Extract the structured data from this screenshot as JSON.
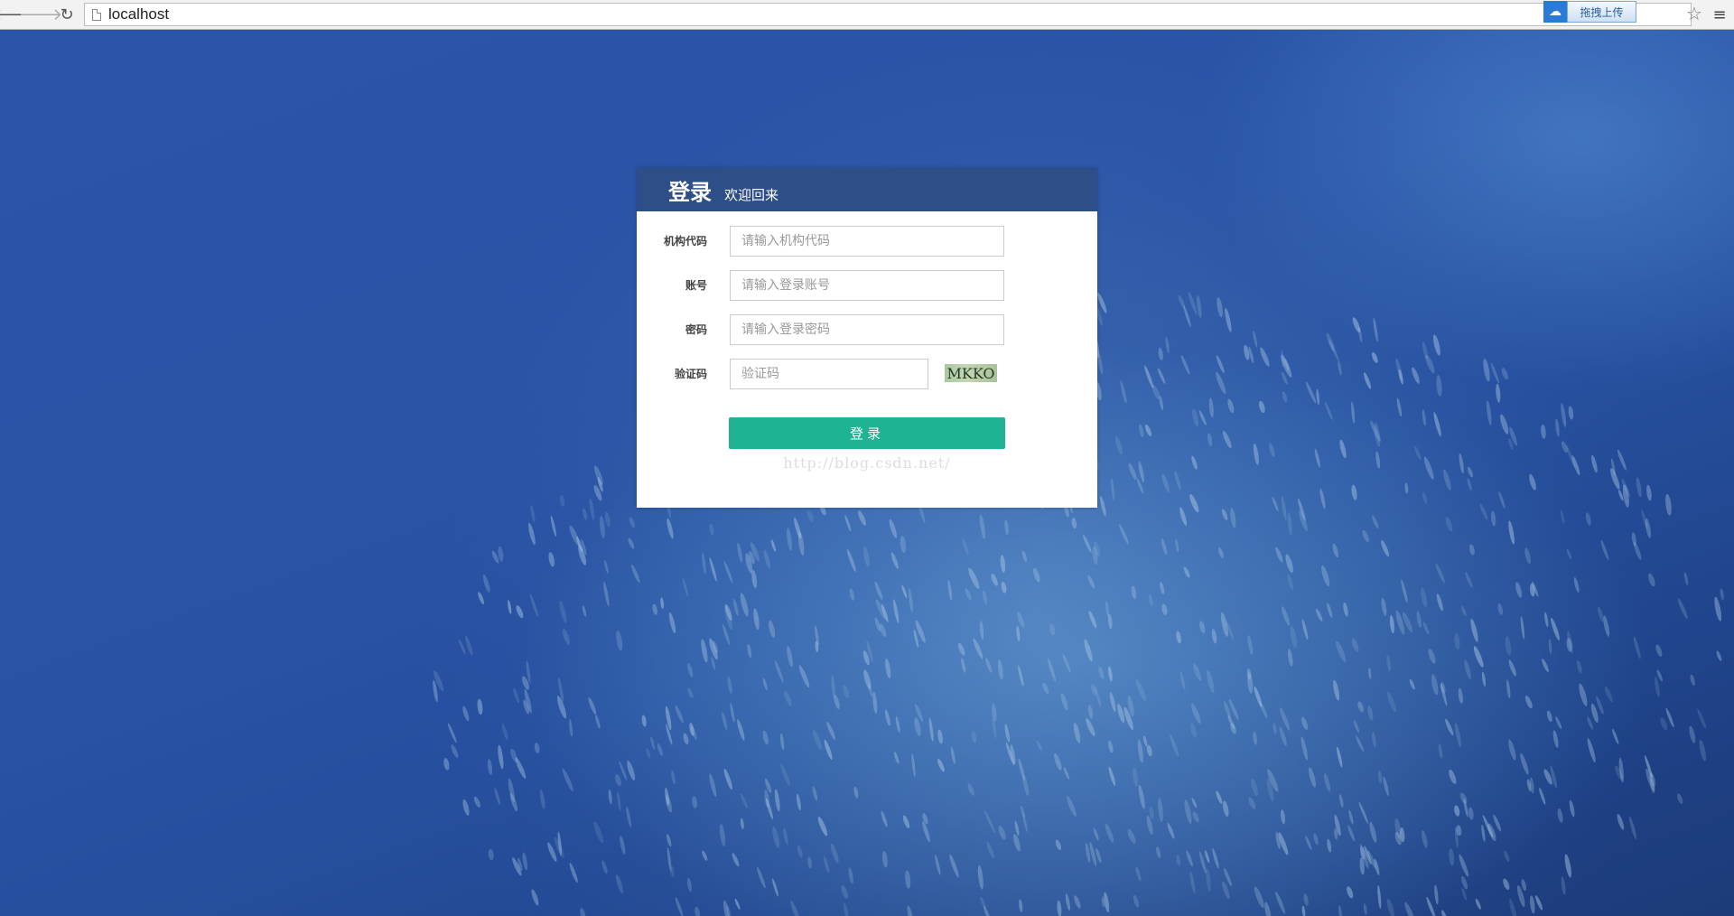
{
  "browser": {
    "url": "localhost",
    "upload_button_label": "拖拽上传",
    "back_glyph": "🡐",
    "forward_glyph": "🡒",
    "reload_glyph": "↻",
    "star_glyph": "☆",
    "menu_glyph": "≡",
    "cloud_glyph": "☁"
  },
  "login": {
    "title": "登录",
    "subtitle": "欢迎回来",
    "fields": {
      "org_code": {
        "label": "机构代码",
        "placeholder": "请输入机构代码"
      },
      "account": {
        "label": "账号",
        "placeholder": "请输入登录账号"
      },
      "password": {
        "label": "密码",
        "placeholder": "请输入登录密码"
      },
      "captcha": {
        "label": "验证码",
        "placeholder": "验证码",
        "captcha_text": "MKKO"
      }
    },
    "submit_label": "登录",
    "watermark": "http://blog.csdn.net/"
  },
  "colors": {
    "header_bg": "#2d4e87",
    "button_bg": "#1eb393",
    "page_bg": "#2a55a8"
  }
}
